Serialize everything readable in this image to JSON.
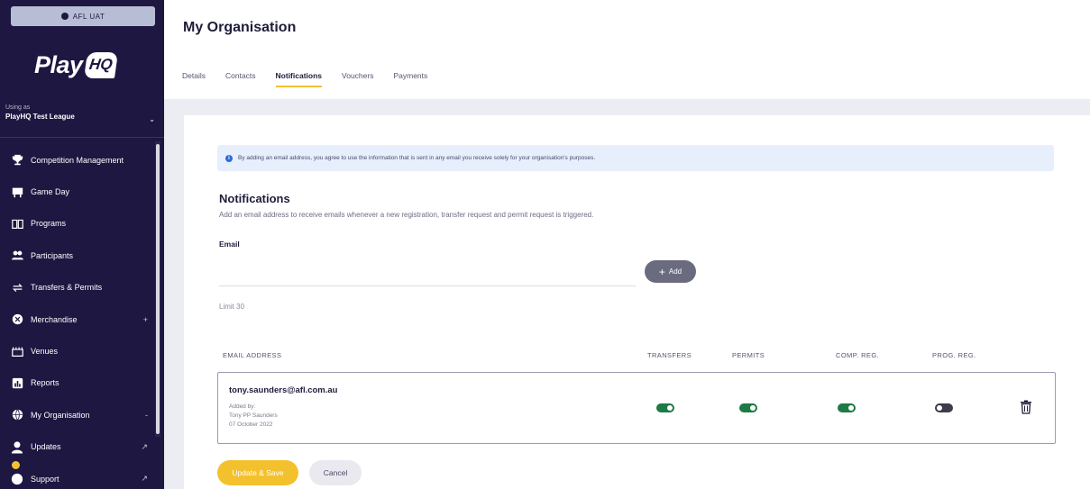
{
  "sidebar": {
    "env_badge": "AFL UAT",
    "logo_play": "Play",
    "logo_hq": "HQ",
    "using_as_label": "Using as",
    "using_as_org": "PlayHQ Test League",
    "items": [
      {
        "label": "Competition Management",
        "icon": "trophy-icon"
      },
      {
        "label": "Game Day",
        "icon": "scoreboard-icon"
      },
      {
        "label": "Programs",
        "icon": "book-icon"
      },
      {
        "label": "Participants",
        "icon": "people-icon"
      },
      {
        "label": "Transfers & Permits",
        "icon": "transfer-arrows-icon"
      },
      {
        "label": "Merchandise",
        "icon": "merchandise-icon",
        "suffix": "+"
      },
      {
        "label": "Venues",
        "icon": "venue-icon"
      },
      {
        "label": "Reports",
        "icon": "report-icon"
      },
      {
        "label": "My Organisation",
        "icon": "globe-icon",
        "suffix": "-"
      },
      {
        "label": "Updates",
        "icon": "updates-icon",
        "suffix": "↗"
      },
      {
        "label": "Support",
        "icon": "support-icon",
        "suffix": "↗"
      }
    ]
  },
  "header": {
    "title": "My Organisation",
    "tabs": [
      "Details",
      "Contacts",
      "Notifications",
      "Vouchers",
      "Payments"
    ],
    "active_tab": "Notifications"
  },
  "main": {
    "info_banner": "By adding an email address, you agree to use the information that is sent in any email you receive solely for your organisation's purposes.",
    "section_title": "Notifications",
    "section_subtitle": "Add an email address to receive emails whenever a new registration, transfer request and permit request is triggered.",
    "email_label": "Email",
    "email_value": "",
    "add_label": "Add",
    "limit_text": "Limit 30",
    "columns": [
      "EMAIL ADDRESS",
      "TRANSFERS",
      "PERMITS",
      "COMP. REG.",
      "PROG. REG."
    ],
    "rows": [
      {
        "email": "tony.saunders@afl.com.au",
        "added_by_label": "Added by:",
        "added_by_name": "Tony PP Saunders",
        "added_date": "07 October 2022",
        "transfers": true,
        "permits": true,
        "comp_reg": true,
        "prog_reg": false
      }
    ],
    "save_label": "Update & Save",
    "cancel_label": "Cancel"
  },
  "colors": {
    "sidebar_bg": "#1d1741",
    "accent_yellow": "#f4c12e",
    "toggle_on": "#1e7a45",
    "info_bg": "#e7effd"
  }
}
